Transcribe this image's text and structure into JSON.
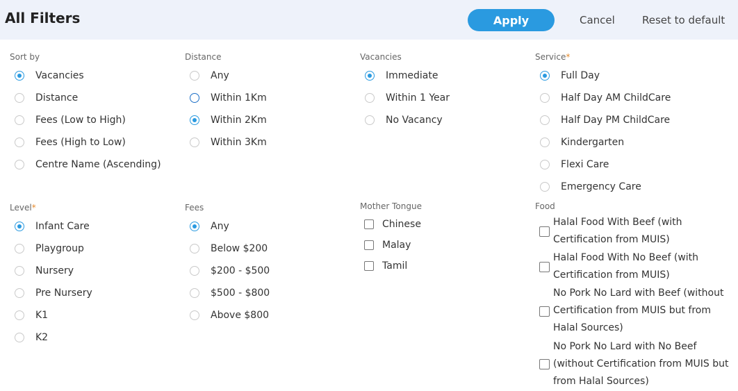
{
  "header": {
    "title": "All Filters",
    "apply_label": "Apply",
    "cancel_label": "Cancel",
    "reset_label": "Reset to default"
  },
  "sort_by": {
    "label": "Sort by",
    "selected": "Vacancies",
    "options": [
      "Vacancies",
      "Distance",
      "Fees (Low to High)",
      "Fees (High to Low)",
      "Centre Name (Ascending)"
    ]
  },
  "distance": {
    "label": "Distance",
    "selected": "Within 2Km",
    "options": [
      "Any",
      "Within 1Km",
      "Within 2Km",
      "Within 3Km"
    ]
  },
  "vacancies": {
    "label": "Vacancies",
    "selected": "Immediate",
    "options": [
      "Immediate",
      "Within 1 Year",
      "No Vacancy"
    ]
  },
  "service": {
    "label": "Service",
    "required_mark": "*",
    "selected": "Full Day",
    "options": [
      "Full Day",
      "Half Day AM ChildCare",
      "Half Day PM ChildCare",
      "Kindergarten",
      "Flexi Care",
      "Emergency Care"
    ]
  },
  "level": {
    "label": "Level",
    "required_mark": "*",
    "selected": "Infant Care",
    "options": [
      "Infant Care",
      "Playgroup",
      "Nursery",
      "Pre Nursery",
      "K1",
      "K2"
    ]
  },
  "fees": {
    "label": "Fees",
    "selected": "Any",
    "options": [
      "Any",
      "Below $200",
      "$200 - $500",
      "$500 - $800",
      "Above $800"
    ]
  },
  "mother_tongue": {
    "label": "Mother Tongue",
    "options": [
      "Chinese",
      "Malay",
      "Tamil"
    ]
  },
  "food": {
    "label": "Food",
    "options": [
      "Halal Food With Beef (with Certification from MUIS)",
      "Halal Food With No Beef (with Certification from MUIS)",
      "No Pork No Lard with Beef (without Certification from MUIS but from Halal Sources)",
      "No Pork No Lard with No Beef (without Certification from MUIS but from Halal Sources)"
    ]
  }
}
